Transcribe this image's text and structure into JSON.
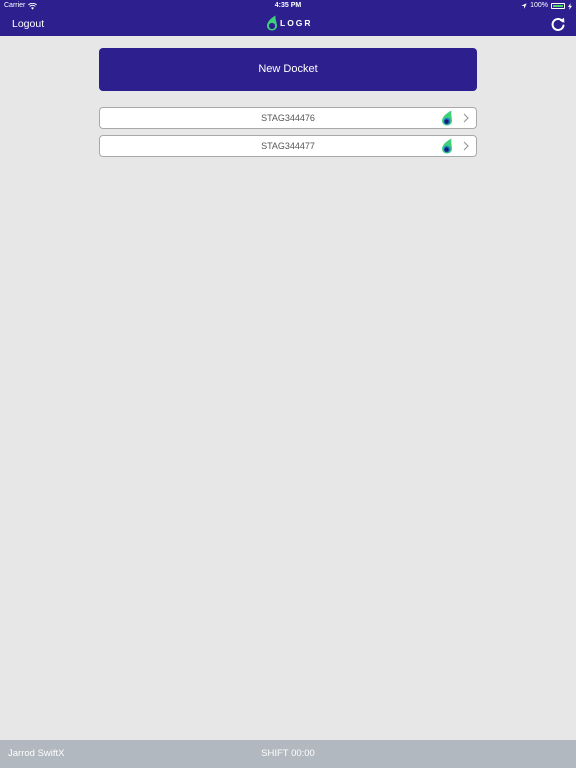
{
  "status_bar": {
    "carrier": "Carrier",
    "time": "4:35 PM",
    "battery_text": "100%",
    "battery_level": 1.0,
    "icons": [
      "wifi-icon",
      "location-arrow-icon",
      "battery-icon",
      "charging-bolt-icon"
    ]
  },
  "nav": {
    "logout_label": "Logout",
    "logo_text": "LOGR",
    "refresh_icon": "refresh-icon"
  },
  "new_docket_label": "New Docket",
  "dockets": [
    {
      "id": "STAG344476",
      "icon": "drop-icon"
    },
    {
      "id": "STAG344477",
      "icon": "drop-icon"
    }
  ],
  "footer": {
    "user": "Jarrod SwiftX",
    "shift": "SHIFT 00:00"
  },
  "colors": {
    "primary": "#2e1f8f",
    "background": "#e7e7e7",
    "footer": "#b1b8c0",
    "drop_green": "#3ed07a",
    "drop_blue": "#1d7fd4",
    "drop_navy": "#1d1a6b"
  }
}
